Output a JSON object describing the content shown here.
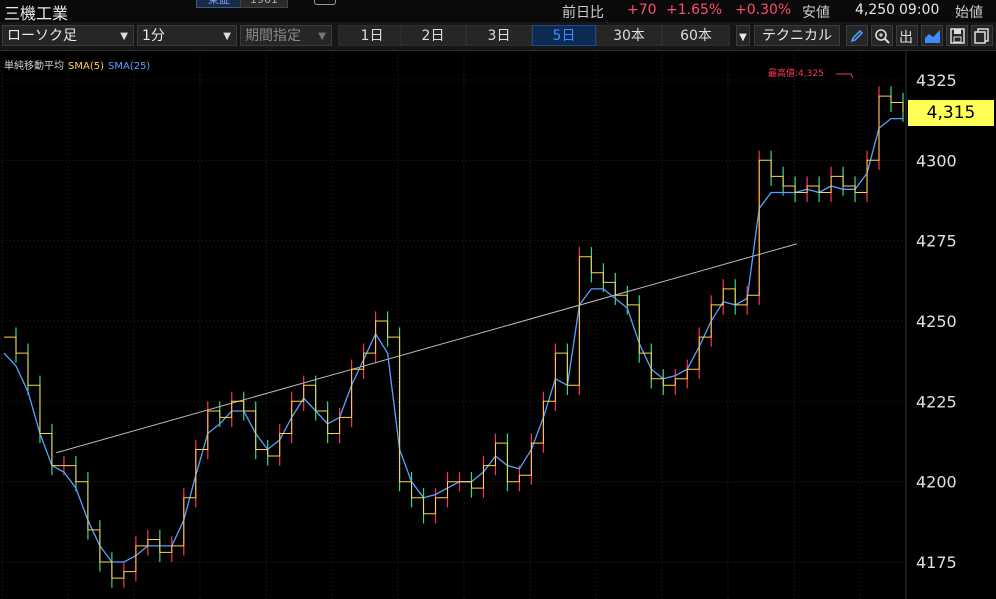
{
  "header": {
    "title": "三機工業",
    "badge_market": "東証",
    "badge_code": "1961",
    "prev_label": "前日比",
    "change": "+70",
    "change_pct": "+1.65%",
    "change_pct2": "+0.30%",
    "low_label": "安値",
    "low_value": "4,250",
    "time": "09:00",
    "open_label": "始値"
  },
  "toolbar": {
    "chart_type": "ローソク足",
    "interval": "1分",
    "range_placeholder": "期間指定",
    "periods": [
      "1日",
      "2日",
      "3日",
      "5日",
      "30本",
      "60本"
    ],
    "active_period": "5日",
    "technical_label": "テクニカル",
    "icons": [
      "pencil-icon",
      "zoom-icon",
      "output-icon",
      "area-chart-icon",
      "save-icon",
      "copy-icon"
    ]
  },
  "legend": {
    "label": "単純移動平均",
    "sma5": "SMA(5)",
    "sma25": "SMA(25)"
  },
  "chart_data": {
    "type": "line",
    "yticks": [
      "4325",
      "4300",
      "4275",
      "4250",
      "4225",
      "4200",
      "4175"
    ],
    "ylim": [
      4165,
      4330
    ],
    "grid": true,
    "current_price": "4,315",
    "high_label": "最高値:4,325",
    "colors": {
      "up": "#ff3355",
      "down": "#33dd88",
      "sma5": "#ffd34d",
      "sma25": "#5aa0ff",
      "trend": "#bbbbbb"
    },
    "series": [
      {
        "name": "SMA(5)",
        "values": [
          4245,
          4240,
          4230,
          4215,
          4205,
          4205,
          4200,
          4185,
          4175,
          4170,
          4172,
          4180,
          4182,
          4178,
          4180,
          4195,
          4210,
          4222,
          4220,
          4225,
          4222,
          4210,
          4208,
          4215,
          4225,
          4230,
          4222,
          4215,
          4220,
          4235,
          4240,
          4250,
          4245,
          4200,
          4195,
          4190,
          4195,
          4200,
          4200,
          4198,
          4205,
          4212,
          4200,
          4202,
          4212,
          4225,
          4240,
          4230,
          4270,
          4265,
          4262,
          4258,
          4255,
          4240,
          4232,
          4230,
          4232,
          4235,
          4245,
          4255,
          4260,
          4255,
          4258,
          4300,
          4295,
          4292,
          4290,
          4292,
          4290,
          4295,
          4292,
          4290,
          4300,
          4320,
          4318,
          4315
        ]
      },
      {
        "name": "SMA(25)",
        "values": [
          4240,
          4236,
          4228,
          4215,
          4205,
          4203,
          4198,
          4188,
          4180,
          4175,
          4175,
          4177,
          4180,
          4180,
          4180,
          4188,
          4202,
          4215,
          4218,
          4222,
          4222,
          4215,
          4210,
          4213,
          4220,
          4226,
          4222,
          4218,
          4220,
          4230,
          4238,
          4246,
          4240,
          4210,
          4200,
          4195,
          4196,
          4198,
          4200,
          4200,
          4203,
          4208,
          4205,
          4204,
          4210,
          4220,
          4232,
          4230,
          4255,
          4260,
          4260,
          4257,
          4254,
          4243,
          4235,
          4232,
          4233,
          4235,
          4242,
          4250,
          4256,
          4255,
          4257,
          4285,
          4290,
          4290,
          4290,
          4291,
          4290,
          4292,
          4291,
          4291,
          4296,
          4310,
          4313,
          4313
        ]
      }
    ],
    "trendline": {
      "from": [
        0.06,
        4209
      ],
      "to": [
        0.88,
        4274
      ]
    }
  }
}
